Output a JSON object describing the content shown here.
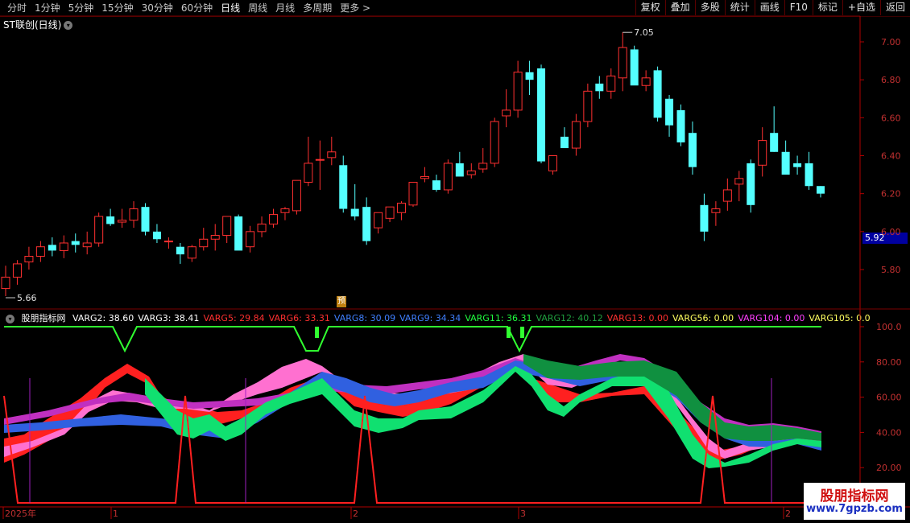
{
  "toolbar": {
    "periods": [
      "分时",
      "1分钟",
      "5分钟",
      "15分钟",
      "30分钟",
      "60分钟",
      "日线",
      "周线",
      "月线",
      "多周期",
      "更多 >"
    ],
    "active_period": "日线",
    "actions": [
      "复权",
      "叠加",
      "多股",
      "统计",
      "画线",
      "F10",
      "标记",
      "+自选",
      "返回"
    ]
  },
  "main_chart": {
    "title": "ST联创(日线)",
    "high_label": "7.05",
    "low_label": "5.66",
    "price_ticks": [
      "7.00",
      "6.80",
      "6.60",
      "6.40",
      "6.20",
      "6.00",
      "5.80"
    ],
    "current_price": "5.92",
    "marker": "预"
  },
  "indicator": {
    "name": "股朋指标网",
    "values": [
      {
        "label": "VARG2: 38.60",
        "color": "#ffffff"
      },
      {
        "label": "VARG3: 38.41",
        "color": "#ffffff"
      },
      {
        "label": "VARG5: 29.84",
        "color": "#ff3030"
      },
      {
        "label": "VARG6: 33.31",
        "color": "#ff3030"
      },
      {
        "label": "VARG8: 30.09",
        "color": "#4080ff"
      },
      {
        "label": "VARG9: 34.34",
        "color": "#4080ff"
      },
      {
        "label": "VARG11: 36.31",
        "color": "#20ff40"
      },
      {
        "label": "VARG12: 40.12",
        "color": "#20a040"
      },
      {
        "label": "VARG13: 0.00",
        "color": "#ff3030"
      },
      {
        "label": "VARG56: 0.00",
        "color": "#ffff60"
      },
      {
        "label": "VARG104: 0.00",
        "color": "#ff40ff"
      },
      {
        "label": "VARG105: 0.0",
        "color": "#ffff60"
      }
    ],
    "ticks": [
      "100.0",
      "80.00",
      "60.00",
      "40.00",
      "20.00"
    ]
  },
  "time_axis": {
    "labels": [
      "2025年",
      "1",
      "2",
      "3",
      "2"
    ]
  },
  "watermark": {
    "title": "股朋指标网",
    "url": "www.7gpzb.com"
  },
  "chart_data": {
    "type": "candlestick",
    "title": "ST联创(日线)",
    "ylim": [
      5.66,
      7.1
    ],
    "candles": [
      [
        5.7,
        5.82,
        5.66,
        5.76
      ],
      [
        5.76,
        5.85,
        5.72,
        5.83
      ],
      [
        5.84,
        5.92,
        5.8,
        5.87
      ],
      [
        5.87,
        5.95,
        5.84,
        5.92
      ],
      [
        5.93,
        5.97,
        5.87,
        5.9
      ],
      [
        5.9,
        5.98,
        5.86,
        5.94
      ],
      [
        5.95,
        5.99,
        5.89,
        5.93
      ],
      [
        5.92,
        6.0,
        5.88,
        5.94
      ],
      [
        5.94,
        6.1,
        5.92,
        6.08
      ],
      [
        6.08,
        6.12,
        6.03,
        6.04
      ],
      [
        6.05,
        6.12,
        6.02,
        6.06
      ],
      [
        6.06,
        6.16,
        6.02,
        6.12
      ],
      [
        6.13,
        6.15,
        5.98,
        6.0
      ],
      [
        6.0,
        6.04,
        5.94,
        5.96
      ],
      [
        5.95,
        5.97,
        5.91,
        5.95
      ],
      [
        5.92,
        5.94,
        5.83,
        5.88
      ],
      [
        5.86,
        5.93,
        5.84,
        5.92
      ],
      [
        5.92,
        6.02,
        5.9,
        5.96
      ],
      [
        5.96,
        6.04,
        5.9,
        5.98
      ],
      [
        5.98,
        6.07,
        5.94,
        6.08
      ],
      [
        6.08,
        6.09,
        5.91,
        5.9
      ],
      [
        5.92,
        6.03,
        5.89,
        6.0
      ],
      [
        6.0,
        6.08,
        5.97,
        6.04
      ],
      [
        6.04,
        6.12,
        6.02,
        6.09
      ],
      [
        6.1,
        6.13,
        6.06,
        6.12
      ],
      [
        6.11,
        6.27,
        6.09,
        6.27
      ],
      [
        6.26,
        6.5,
        6.24,
        6.36
      ],
      [
        6.38,
        6.48,
        6.22,
        6.38
      ],
      [
        6.39,
        6.5,
        6.35,
        6.42
      ],
      [
        6.35,
        6.4,
        6.1,
        6.12
      ],
      [
        6.12,
        6.25,
        6.06,
        6.08
      ],
      [
        6.13,
        6.18,
        5.93,
        5.95
      ],
      [
        6.02,
        6.1,
        5.99,
        6.1
      ],
      [
        6.07,
        6.12,
        6.05,
        6.13
      ],
      [
        6.1,
        6.16,
        6.06,
        6.15
      ],
      [
        6.14,
        6.26,
        6.13,
        6.26
      ],
      [
        6.28,
        6.34,
        6.26,
        6.29
      ],
      [
        6.27,
        6.3,
        6.21,
        6.22
      ],
      [
        6.22,
        6.38,
        6.2,
        6.36
      ],
      [
        6.36,
        6.42,
        6.3,
        6.29
      ],
      [
        6.3,
        6.36,
        6.28,
        6.32
      ],
      [
        6.33,
        6.44,
        6.31,
        6.36
      ],
      [
        6.36,
        6.6,
        6.34,
        6.58
      ],
      [
        6.61,
        6.75,
        6.55,
        6.64
      ],
      [
        6.64,
        6.9,
        6.6,
        6.84
      ],
      [
        6.84,
        6.9,
        6.72,
        6.8
      ],
      [
        6.86,
        6.88,
        6.36,
        6.37
      ],
      [
        6.32,
        6.4,
        6.3,
        6.4
      ],
      [
        6.5,
        6.55,
        6.46,
        6.44
      ],
      [
        6.44,
        6.62,
        6.4,
        6.58
      ],
      [
        6.58,
        6.78,
        6.55,
        6.74
      ],
      [
        6.78,
        6.82,
        6.7,
        6.74
      ],
      [
        6.74,
        6.86,
        6.7,
        6.82
      ],
      [
        6.81,
        7.05,
        6.74,
        6.97
      ],
      [
        6.96,
        6.98,
        6.8,
        6.77
      ],
      [
        6.77,
        6.85,
        6.74,
        6.81
      ],
      [
        6.85,
        6.87,
        6.58,
        6.6
      ],
      [
        6.7,
        6.72,
        6.5,
        6.56
      ],
      [
        6.64,
        6.67,
        6.45,
        6.47
      ],
      [
        6.52,
        6.58,
        6.3,
        6.34
      ],
      [
        6.14,
        6.2,
        5.95,
        6.0
      ],
      [
        6.1,
        6.16,
        6.03,
        6.12
      ],
      [
        6.16,
        6.28,
        6.11,
        6.22
      ],
      [
        6.25,
        6.32,
        6.16,
        6.28
      ],
      [
        6.36,
        6.38,
        6.1,
        6.14
      ],
      [
        6.35,
        6.55,
        6.29,
        6.48
      ],
      [
        6.52,
        6.66,
        6.42,
        6.42
      ],
      [
        6.42,
        6.48,
        6.38,
        6.3
      ],
      [
        6.36,
        6.4,
        6.3,
        6.34
      ],
      [
        6.36,
        6.42,
        6.22,
        6.24
      ],
      [
        6.24,
        6.24,
        6.18,
        6.2
      ]
    ]
  }
}
